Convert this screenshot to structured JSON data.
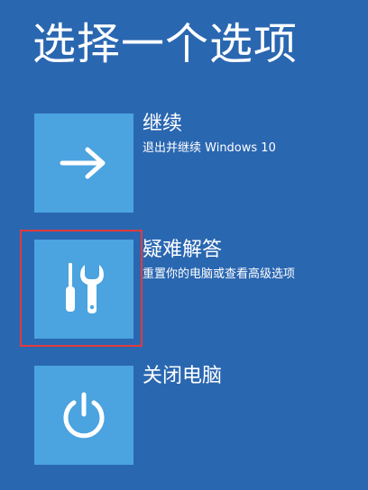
{
  "page": {
    "title": "选择一个选项"
  },
  "options": [
    {
      "id": "continue",
      "title": "继续",
      "description": "退出并继续 Windows 10",
      "icon": "arrow-right-icon"
    },
    {
      "id": "troubleshoot",
      "title": "疑难解答",
      "description": "重置你的电脑或查看高级选项",
      "icon": "tools-icon"
    },
    {
      "id": "shutdown",
      "title": "关闭电脑",
      "description": "",
      "icon": "power-icon"
    }
  ],
  "colors": {
    "background": "#2a67b1",
    "tile": "#4ba3df",
    "highlight": "#e03b3b",
    "text": "#ffffff"
  }
}
